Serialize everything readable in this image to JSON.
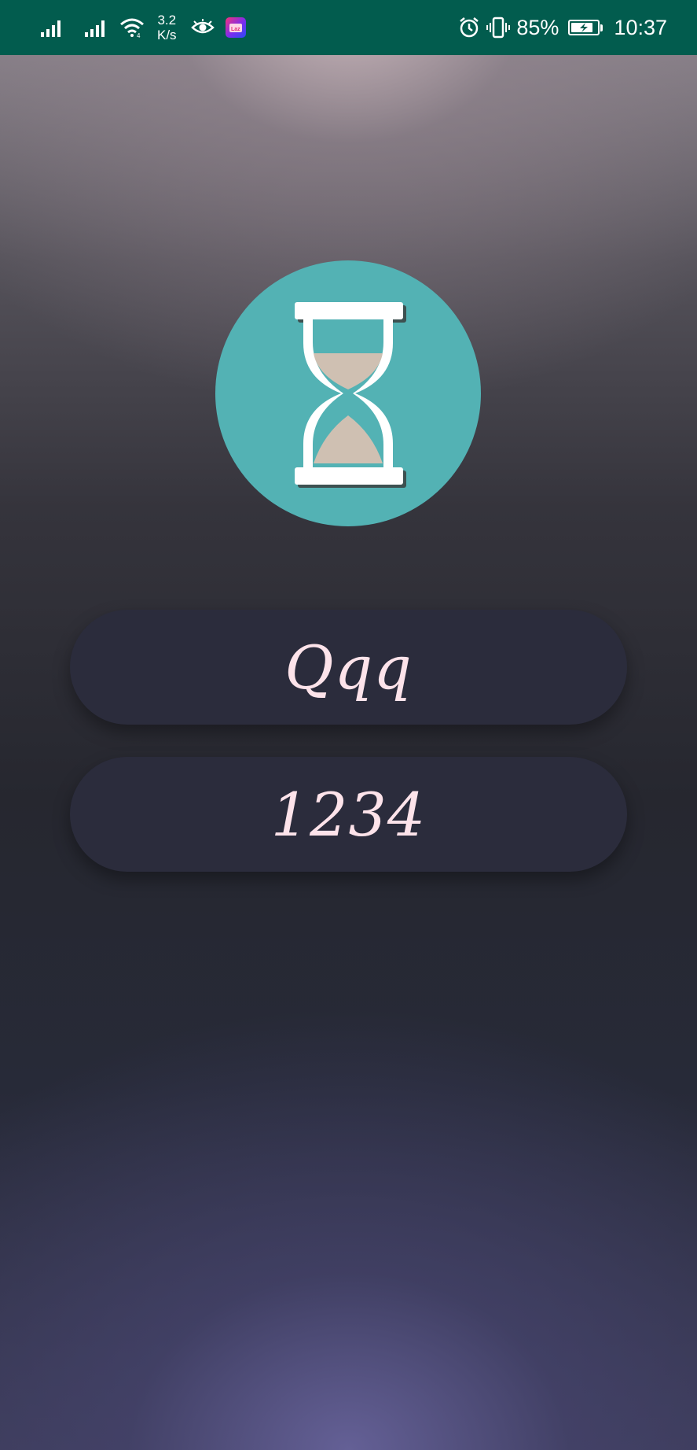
{
  "status_bar": {
    "speed_value": "3.2",
    "speed_unit": "K/s",
    "battery_percent": "85%",
    "battery_level": 0.85,
    "time": "10:37",
    "icons": [
      "signal-icon",
      "signal-icon",
      "wifi-icon",
      "eye-icon",
      "lazada-app-icon",
      "alarm-icon",
      "vibrate-icon",
      "battery-charging-icon"
    ],
    "background_color": "#025c4e"
  },
  "logo": {
    "icon": "hourglass-icon",
    "circle_color": "#53b2b4",
    "sand_color": "#cfc0b2"
  },
  "form": {
    "username_value": "Qqq",
    "password_value": "1234",
    "field_color": "#2b2c3c",
    "text_color": "#fde3ea"
  }
}
